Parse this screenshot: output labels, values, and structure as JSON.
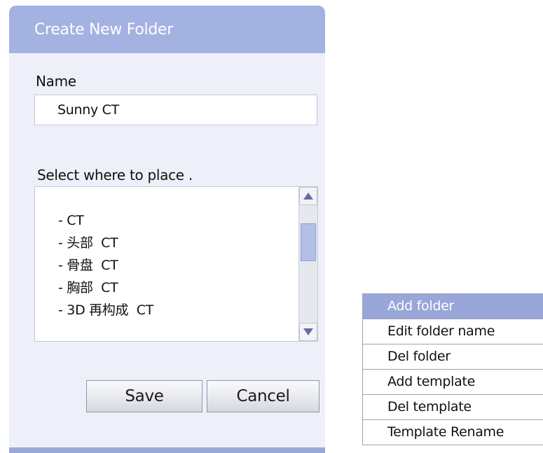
{
  "dialog": {
    "title": "Create New Folder",
    "name_label": "Name",
    "name_value": "Sunny CT",
    "place_label": "Select where to place .",
    "folders": [
      "- CT",
      "- 头部  CT",
      "- 骨盘  CT",
      "- 胸部  CT",
      "- 3D 再构成  CT"
    ],
    "save_label": "Save",
    "cancel_label": "Cancel"
  },
  "context_menu": {
    "items": [
      "Add folder",
      "Edit folder name",
      "Del folder",
      "Add template",
      "Del template",
      "Template Rename"
    ],
    "highlighted_index": 0
  },
  "colors": {
    "title_bar": "#a4b2e2",
    "dialog_bg": "#eef0f9",
    "menu_highlight": "#98a6da"
  },
  "icons": {
    "scroll_up": "triangle-up-icon",
    "scroll_down": "triangle-down-icon"
  }
}
